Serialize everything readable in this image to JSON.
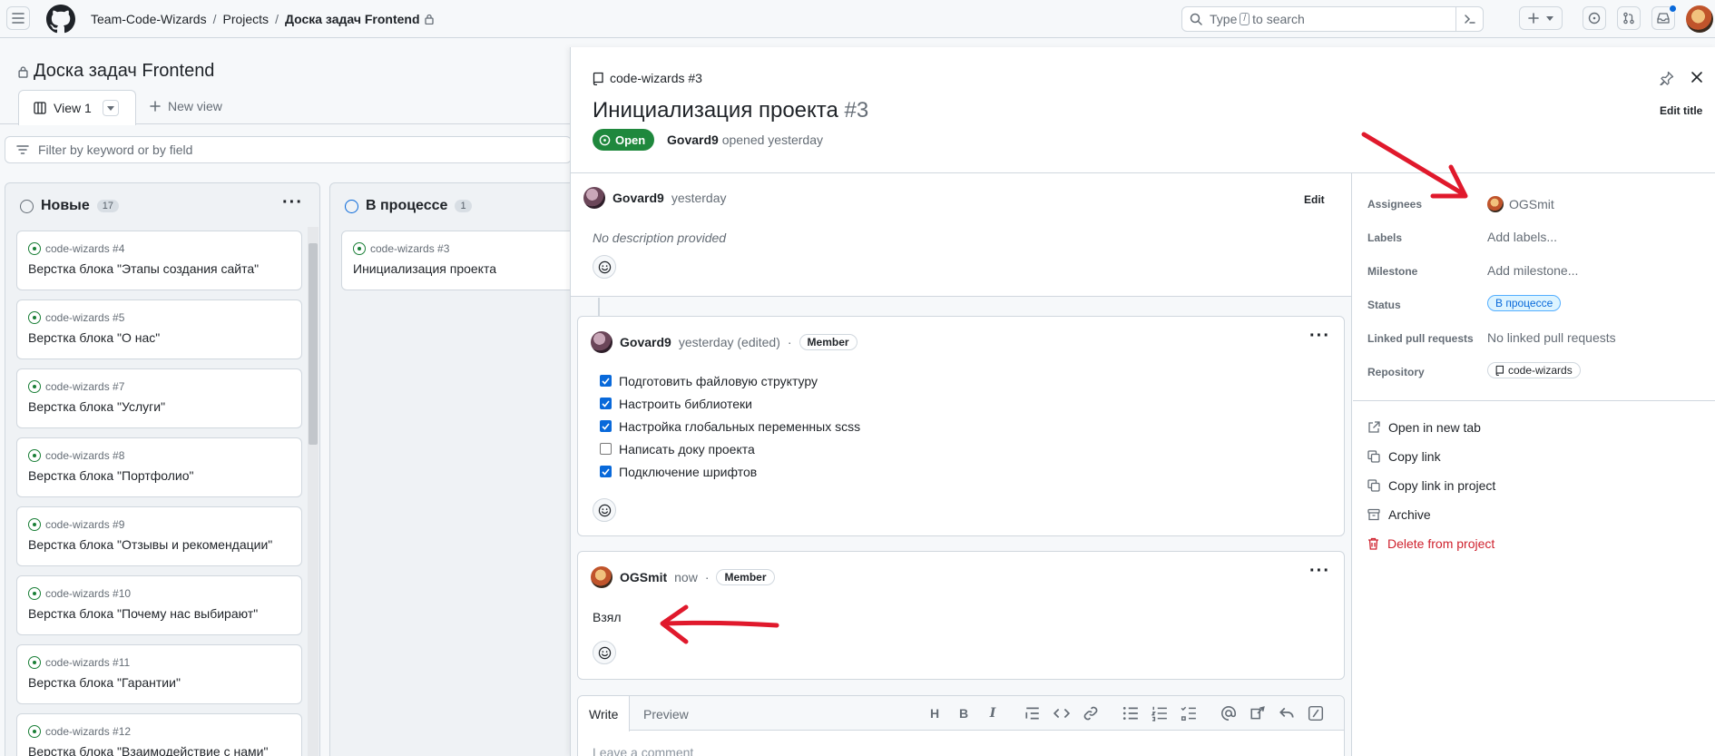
{
  "topbar": {
    "breadcrumbs": [
      "Team-Code-Wizards",
      "Projects",
      "Доска задач Frontend"
    ],
    "search_prefix": "Type",
    "search_key": "/",
    "search_suffix": "to search"
  },
  "board": {
    "title": "Доска задач Frontend",
    "view_tab": "View 1",
    "new_view": "New view",
    "filter_placeholder": "Filter by keyword or by field",
    "columns": [
      {
        "name": "Новые",
        "count": "17",
        "cards": [
          {
            "ref": "code-wizards #4",
            "title": "Верстка блока \"Этапы создания сайта\""
          },
          {
            "ref": "code-wizards #5",
            "title": "Верстка блока \"О нас\""
          },
          {
            "ref": "code-wizards #7",
            "title": "Верстка блока \"Услуги\""
          },
          {
            "ref": "code-wizards #8",
            "title": "Верстка блока \"Портфолио\""
          },
          {
            "ref": "code-wizards #9",
            "title": "Верстка блока \"Отзывы и рекомендации\""
          },
          {
            "ref": "code-wizards #10",
            "title": "Верстка блока \"Почему нас выбирают\""
          },
          {
            "ref": "code-wizards #11",
            "title": "Верстка блока \"Гарантии\""
          },
          {
            "ref": "code-wizards #12",
            "title": "Верстка блока \"Взаимодействие с нами\""
          }
        ]
      },
      {
        "name": "В процессе",
        "count": "1",
        "cards": [
          {
            "ref": "code-wizards #3",
            "title": "Инициализация проекта"
          }
        ]
      }
    ]
  },
  "panel": {
    "repo_ref": "code-wizards #3",
    "title": "Инициализация проекта",
    "number": "#3",
    "state": "Open",
    "author": "Govard9",
    "opened_text": "opened yesterday",
    "edit_title": "Edit title",
    "comments": [
      {
        "author": "Govard9",
        "time": "yesterday",
        "edit": "Edit",
        "body": "No description provided"
      },
      {
        "author": "Govard9",
        "time": "yesterday (edited)",
        "role": "Member",
        "tasks": [
          {
            "label": "Подготовить файловую структуру",
            "checked": true
          },
          {
            "label": "Настроить библиотеки",
            "checked": true
          },
          {
            "label": "Настройка глобальных переменных scss",
            "checked": true
          },
          {
            "label": "Написать доку проекта",
            "checked": false
          },
          {
            "label": "Подключение шрифтов",
            "checked": true
          }
        ]
      },
      {
        "author": "OGSmit",
        "time": "now",
        "role": "Member",
        "body": "Взял"
      }
    ],
    "editor": {
      "write_tab": "Write",
      "preview_tab": "Preview",
      "placeholder": "Leave a comment"
    },
    "sidebar": {
      "fields": [
        {
          "label": "Assignees",
          "value": "OGSmit"
        },
        {
          "label": "Labels",
          "value": "Add labels..."
        },
        {
          "label": "Milestone",
          "value": "Add milestone..."
        },
        {
          "label": "Status",
          "value": "В процессе"
        },
        {
          "label": "Linked pull requests",
          "value": "No linked pull requests"
        },
        {
          "label": "Repository",
          "value": "code-wizards"
        }
      ],
      "actions": [
        "Open in new tab",
        "Copy link",
        "Copy link in project",
        "Archive",
        "Delete from project"
      ]
    }
  },
  "colors": {
    "open_green": "#1f883d",
    "accent_blue": "#0969da",
    "danger_red": "#cf222e",
    "annotation_red": "#e0192c"
  }
}
